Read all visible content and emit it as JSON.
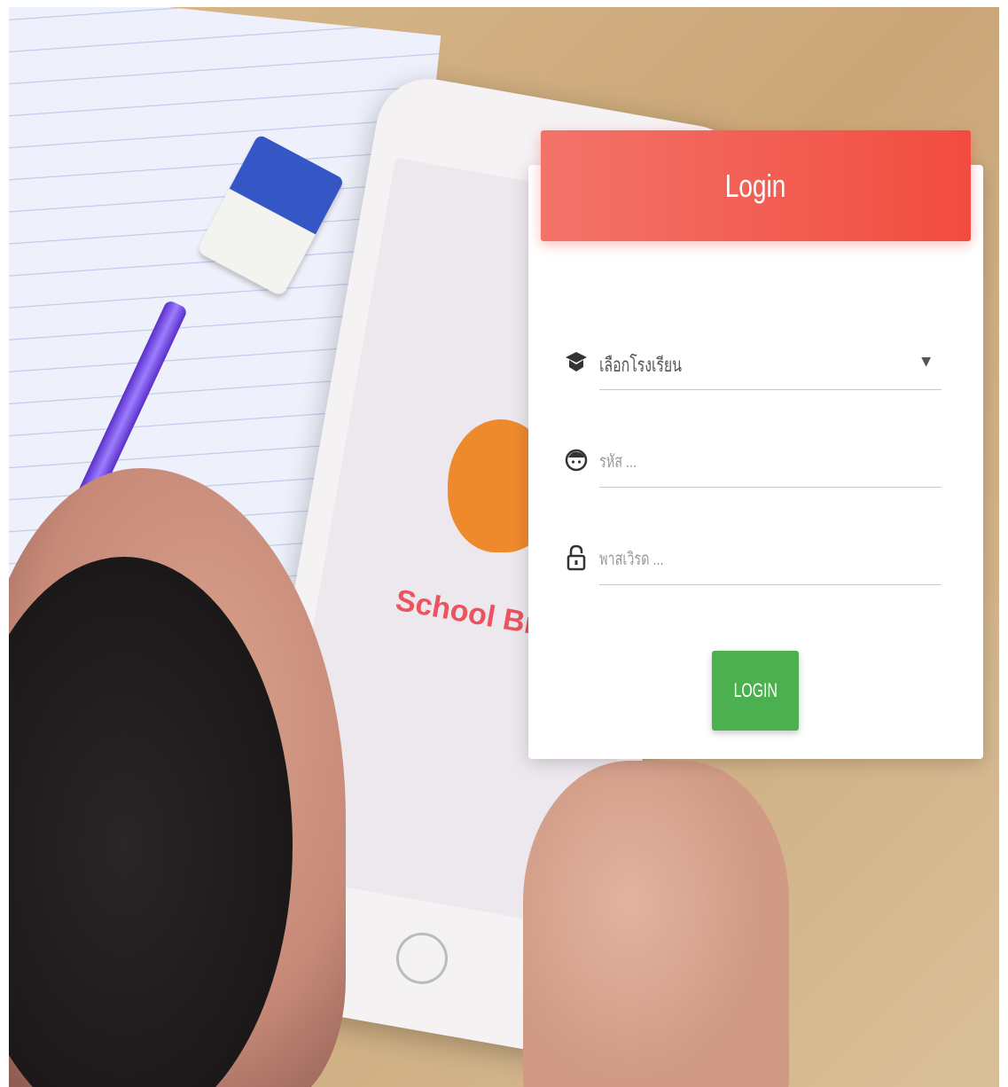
{
  "login": {
    "title": "Login",
    "school_select": {
      "value": "เลือกโรงเรียน",
      "icon": "graduation-cap-icon"
    },
    "code_field": {
      "placeholder": "รหัส ...",
      "icon": "face-icon"
    },
    "password_field": {
      "placeholder": "พาสเวิรด ...",
      "icon": "lock-icon"
    },
    "button_label": "LOGIN"
  },
  "background": {
    "brand_text": "School Bright"
  },
  "colors": {
    "header_start": "#f2736a",
    "header_end": "#f24c3f",
    "button": "#4caf50"
  }
}
